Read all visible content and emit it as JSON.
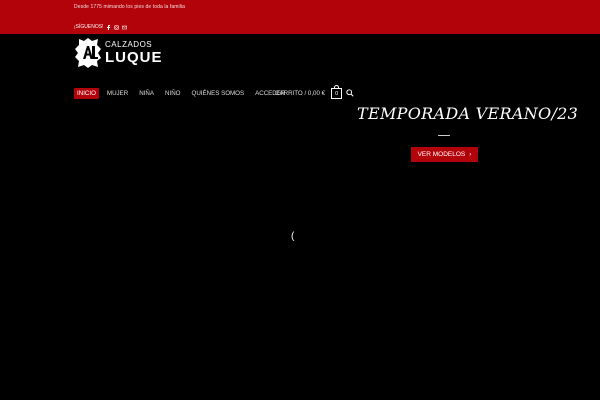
{
  "topbar": {
    "tagline": "Desde 1775 mimando los pies de toda la familia",
    "follow_label": "¡SÍGUENOS!",
    "social_icons": [
      "facebook-icon",
      "instagram-icon",
      "email-icon"
    ]
  },
  "brand": {
    "line1": "CALZADOS",
    "line2": "LUQUE"
  },
  "nav": {
    "items": [
      {
        "label": "INICIO",
        "active": true
      },
      {
        "label": "MUJER"
      },
      {
        "label": "NIÑA"
      },
      {
        "label": "NIÑO"
      },
      {
        "label": "QUIÉNES SOMOS"
      },
      {
        "label": "ACCEDER"
      }
    ],
    "cart_label": "CARRITO / 0,00 €",
    "cart_count": "0"
  },
  "hero": {
    "title": "TEMPORADA VERANO/23",
    "cta_label": "VER MODELOS",
    "cta_chevron": "›"
  },
  "loader": "(",
  "colors": {
    "accent": "#b3030a",
    "background": "#000000"
  }
}
